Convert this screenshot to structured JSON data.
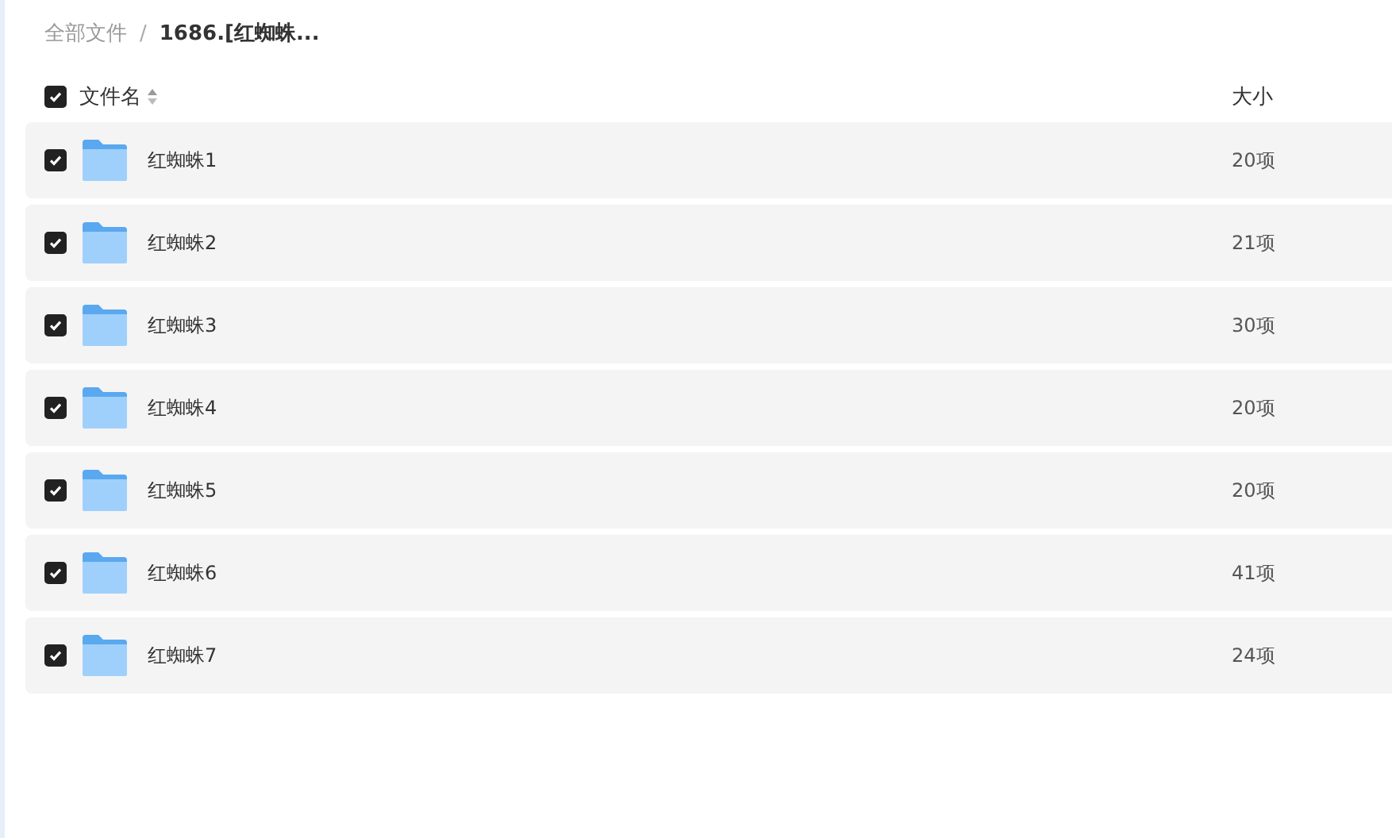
{
  "breadcrumb": [
    {
      "label": "全部文件",
      "current": false
    },
    {
      "label": "1686.[红蜘蛛...",
      "current": true
    }
  ],
  "separator": "/",
  "header": {
    "checked": true,
    "name_label": "文件名",
    "size_label": "大小"
  },
  "rows": [
    {
      "name": "红蜘蛛1",
      "size": "20项",
      "checked": true
    },
    {
      "name": "红蜘蛛2",
      "size": "21项",
      "checked": true
    },
    {
      "name": "红蜘蛛3",
      "size": "30项",
      "checked": true
    },
    {
      "name": "红蜘蛛4",
      "size": "20项",
      "checked": true
    },
    {
      "name": "红蜘蛛5",
      "size": "20项",
      "checked": true
    },
    {
      "name": "红蜘蛛6",
      "size": "41项",
      "checked": true
    },
    {
      "name": "红蜘蛛7",
      "size": "24项",
      "checked": true
    }
  ]
}
